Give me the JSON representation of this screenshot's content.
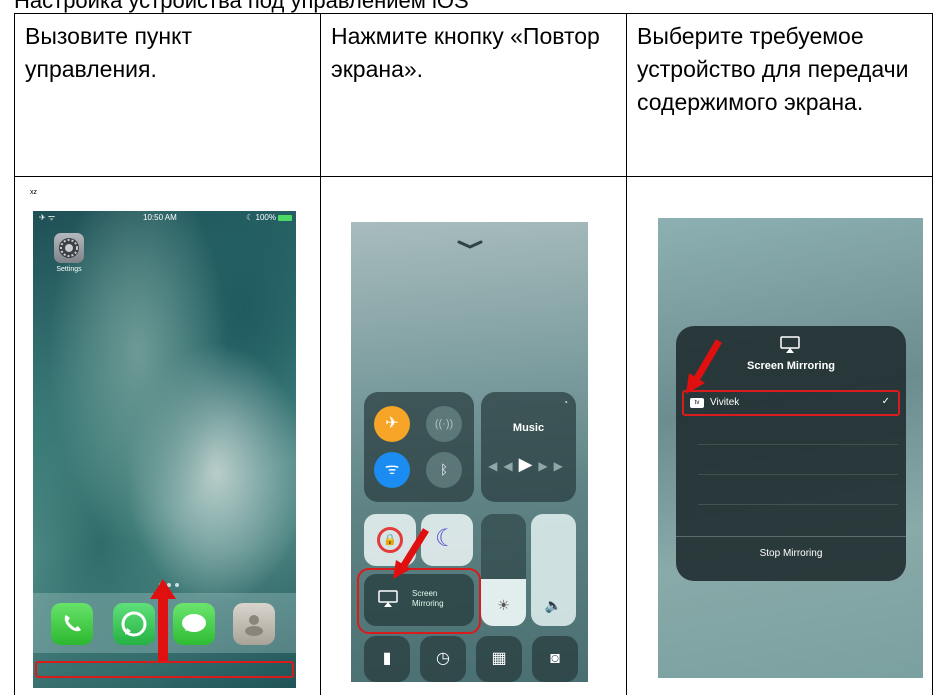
{
  "heading": "Настройка устройства под управлением iOS",
  "steps": [
    {
      "text": "Вызовите пункт управления."
    },
    {
      "text": "Нажмите кнопку «Повтор экрана»."
    },
    {
      "text": "Выберите требуемое устройство для передачи содержимого экрана."
    }
  ],
  "phone1": {
    "corner_mark": "xz",
    "status_left": "✈ ᯤ",
    "time": "10:50 AM",
    "battery": "☾ 100%",
    "settings_label": "Settings"
  },
  "phone2": {
    "music_label": "Music",
    "mirror_label_1": "Screen",
    "mirror_label_2": "Mirroring"
  },
  "phone3": {
    "title": "Screen Mirroring",
    "tv_badge": "tv",
    "device_name": "Vivitek",
    "stop_label": "Stop Mirroring"
  },
  "colors": {
    "highlight_red": "#d81c1c",
    "arrow_red": "#e01010",
    "airplane_orange": "#f7a526",
    "wifi_blue": "#1a8cf2"
  }
}
